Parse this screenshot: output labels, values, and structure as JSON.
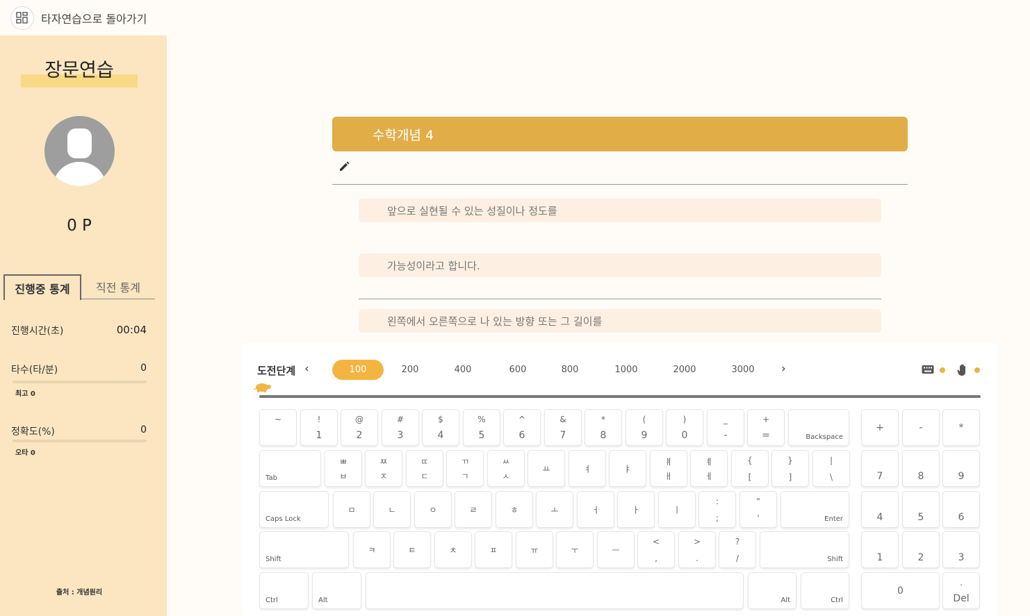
{
  "sidebar": {
    "back_label": "타자연습으로 돌아가기",
    "back_icon": "grid-app-icon",
    "title": "장문연습",
    "points": "0 P",
    "tabs": [
      "진행중 통계",
      "직전 통계"
    ],
    "stats": {
      "time_label": "진행시간(초)",
      "time_value": "00:04",
      "speed_label": "타수(타/분)",
      "speed_value": "0",
      "speed_best": "최고 0",
      "accuracy_label": "정확도(%)",
      "accuracy_value": "0",
      "accuracy_errors": "오타 0"
    },
    "source": "출처 : 개념원리"
  },
  "main": {
    "title": "수학개념 4",
    "sentences": [
      "앞으로 실현될 수 있는 성질이나 정도를",
      "가능성이라고 합니다.",
      "왼쪽에서 오른쪽으로 나 있는 방향 또는 그 길이를"
    ]
  },
  "keyboard_panel": {
    "level_label": "도전단계",
    "prev": "‹",
    "next": "›",
    "levels": [
      "100",
      "200",
      "400",
      "600",
      "800",
      "1000",
      "2000",
      "3000"
    ],
    "active_level": "100",
    "icons": [
      "keyboard-icon",
      "hand-icon"
    ],
    "accent_color": "#f3b441"
  },
  "keys": {
    "row1": [
      [
        "~",
        ""
      ],
      [
        "!",
        "1"
      ],
      [
        "@",
        "2"
      ],
      [
        "#",
        "3"
      ],
      [
        "$",
        "4"
      ],
      [
        "%",
        "5"
      ],
      [
        "^",
        "6"
      ],
      [
        "&",
        "7"
      ],
      [
        "*",
        "8"
      ],
      [
        "(",
        "9"
      ],
      [
        ")",
        "0"
      ],
      [
        "_",
        "-"
      ],
      [
        "+",
        "="
      ]
    ],
    "backspace": "Backspace",
    "tab": "Tab",
    "row2": [
      [
        "ㅃ",
        "ㅂ"
      ],
      [
        "ㅉ",
        "ㅈ"
      ],
      [
        "ㄸ",
        "ㄷ"
      ],
      [
        "ㄲ",
        "ㄱ"
      ],
      [
        "ㅆ",
        "ㅅ"
      ],
      [
        "",
        "ㅛ"
      ],
      [
        "",
        "ㅕ"
      ],
      [
        "",
        "ㅑ"
      ],
      [
        "ㅒ",
        "ㅐ"
      ],
      [
        "ㅖ",
        "ㅔ"
      ],
      [
        "{",
        "["
      ],
      [
        "}",
        "]"
      ],
      [
        "|",
        "\\"
      ]
    ],
    "capslock": "Caps Lock",
    "row3": [
      [
        "",
        "ㅁ"
      ],
      [
        "",
        "ㄴ"
      ],
      [
        "",
        "ㅇ"
      ],
      [
        "",
        "ㄹ"
      ],
      [
        "",
        "ㅎ"
      ],
      [
        "",
        "ㅗ"
      ],
      [
        "",
        "ㅓ"
      ],
      [
        "",
        "ㅏ"
      ],
      [
        "",
        "ㅣ"
      ],
      [
        ":",
        ";"
      ],
      [
        "\"",
        "'"
      ]
    ],
    "enter": "Enter",
    "shift": "Shift",
    "row4": [
      [
        "",
        "ㅋ"
      ],
      [
        "",
        "ㅌ"
      ],
      [
        "",
        "ㅊ"
      ],
      [
        "",
        "ㅍ"
      ],
      [
        "",
        "ㅠ"
      ],
      [
        "",
        "ㅜ"
      ],
      [
        "",
        "ㅡ"
      ],
      [
        "<",
        ","
      ],
      [
        ">",
        "."
      ],
      [
        "?",
        "/"
      ]
    ],
    "ctrl": "Ctrl",
    "alt": "Alt",
    "numpad_ops": [
      "+",
      "-",
      "*"
    ],
    "numpad_rows": [
      [
        "7",
        "8",
        "9"
      ],
      [
        "4",
        "5",
        "6"
      ],
      [
        "1",
        "2",
        "3"
      ]
    ],
    "numpad_zero": "0",
    "numpad_del_top": ".",
    "numpad_del": "Del"
  }
}
